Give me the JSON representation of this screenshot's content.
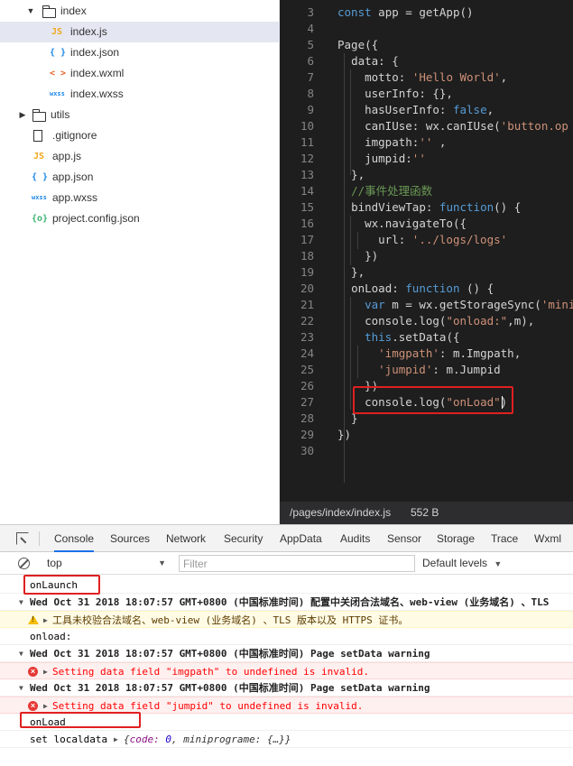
{
  "file_tree": [
    {
      "label": "index",
      "type": "folder",
      "expanded": true,
      "level": 1
    },
    {
      "label": "index.js",
      "type": "js",
      "icon_text": "JS",
      "level": 2,
      "selected": true
    },
    {
      "label": "index.json",
      "type": "json",
      "icon_text": "{ }",
      "level": 2
    },
    {
      "label": "index.wxml",
      "type": "wxml",
      "icon_text": "< >",
      "level": 2
    },
    {
      "label": "index.wxss",
      "type": "wxss",
      "icon_text": "wxss",
      "level": 2
    },
    {
      "label": "utils",
      "type": "folder",
      "expanded": false,
      "level": 0
    },
    {
      "label": ".gitignore",
      "type": "file",
      "level": 0
    },
    {
      "label": "app.js",
      "type": "js",
      "icon_text": "JS",
      "level": 0
    },
    {
      "label": "app.json",
      "type": "json",
      "icon_text": "{ }",
      "level": 0
    },
    {
      "label": "app.wxss",
      "type": "wxss",
      "icon_text": "wxss",
      "level": 0
    },
    {
      "label": "project.config.json",
      "type": "cfg",
      "icon_text": "{o}",
      "level": 0
    }
  ],
  "editor": {
    "lines": [
      {
        "n": "3",
        "code": "const app = getApp()"
      },
      {
        "n": "4",
        "code": ""
      },
      {
        "n": "5",
        "code": "Page({"
      },
      {
        "n": "6",
        "code": "  data: {"
      },
      {
        "n": "7",
        "code": "    motto: 'Hello World',"
      },
      {
        "n": "8",
        "code": "    userInfo: {},"
      },
      {
        "n": "9",
        "code": "    hasUserInfo: false,"
      },
      {
        "n": "10",
        "code": "    canIUse: wx.canIUse('button.op"
      },
      {
        "n": "11",
        "code": "    imgpath:'' ,"
      },
      {
        "n": "12",
        "code": "    jumpid:''"
      },
      {
        "n": "13",
        "code": "  },"
      },
      {
        "n": "14",
        "code": "  //事件处理函数"
      },
      {
        "n": "15",
        "code": "  bindViewTap: function() {"
      },
      {
        "n": "16",
        "code": "    wx.navigateTo({"
      },
      {
        "n": "17",
        "code": "      url: '../logs/logs'"
      },
      {
        "n": "18",
        "code": "    })"
      },
      {
        "n": "19",
        "code": "  },"
      },
      {
        "n": "20",
        "code": "  onLoad: function () {"
      },
      {
        "n": "21",
        "code": "    var m = wx.getStorageSync('mini"
      },
      {
        "n": "22",
        "code": "    console.log(\"onload:\",m),"
      },
      {
        "n": "23",
        "code": "    this.setData({"
      },
      {
        "n": "24",
        "code": "      'imgpath': m.Imgpath,"
      },
      {
        "n": "25",
        "code": "      'jumpid': m.Jumpid"
      },
      {
        "n": "26",
        "code": "    })"
      },
      {
        "n": "27",
        "code": "    console.log(\"onLoad\")"
      },
      {
        "n": "28",
        "code": "  }"
      },
      {
        "n": "29",
        "code": "})"
      },
      {
        "n": "30",
        "code": ""
      }
    ]
  },
  "statusbar": {
    "path": "/pages/index/index.js",
    "size": "552 B"
  },
  "devtools": {
    "tabs": [
      "Console",
      "Sources",
      "Network",
      "Security",
      "AppData",
      "Audits",
      "Sensor",
      "Storage",
      "Trace",
      "Wxml"
    ],
    "active_tab": "Console",
    "context": "top",
    "filter_placeholder": "Filter",
    "levels": "Default levels"
  },
  "console": [
    {
      "kind": "log",
      "text": "onLaunch"
    },
    {
      "kind": "group",
      "text": "Wed Oct 31 2018 18:07:57 GMT+0800 (中国标准时间) 配置中关闭合法域名、web-view (业务域名) 、TLS"
    },
    {
      "kind": "warn",
      "text": "工具未校验合法域名、web-view (业务域名) 、TLS 版本以及 HTTPS 证书。"
    },
    {
      "kind": "log",
      "text": "onload:"
    },
    {
      "kind": "group",
      "text": "Wed Oct 31 2018 18:07:57 GMT+0800 (中国标准时间) Page setData warning"
    },
    {
      "kind": "err",
      "text": "Setting data field \"imgpath\" to undefined is invalid."
    },
    {
      "kind": "group",
      "text": "Wed Oct 31 2018 18:07:57 GMT+0800 (中国标准时间) Page setData warning"
    },
    {
      "kind": "err",
      "text": "Setting data field \"jumpid\" to undefined is invalid."
    },
    {
      "kind": "log",
      "text": "onLoad"
    },
    {
      "kind": "obj",
      "text": "set localdata",
      "obj_code": "0",
      "obj_rest": "miniprograme: {…}"
    }
  ],
  "colors": {
    "highlight": "#e02020",
    "editor_bg": "#1e1e1e",
    "accent": "#1a73e8"
  }
}
